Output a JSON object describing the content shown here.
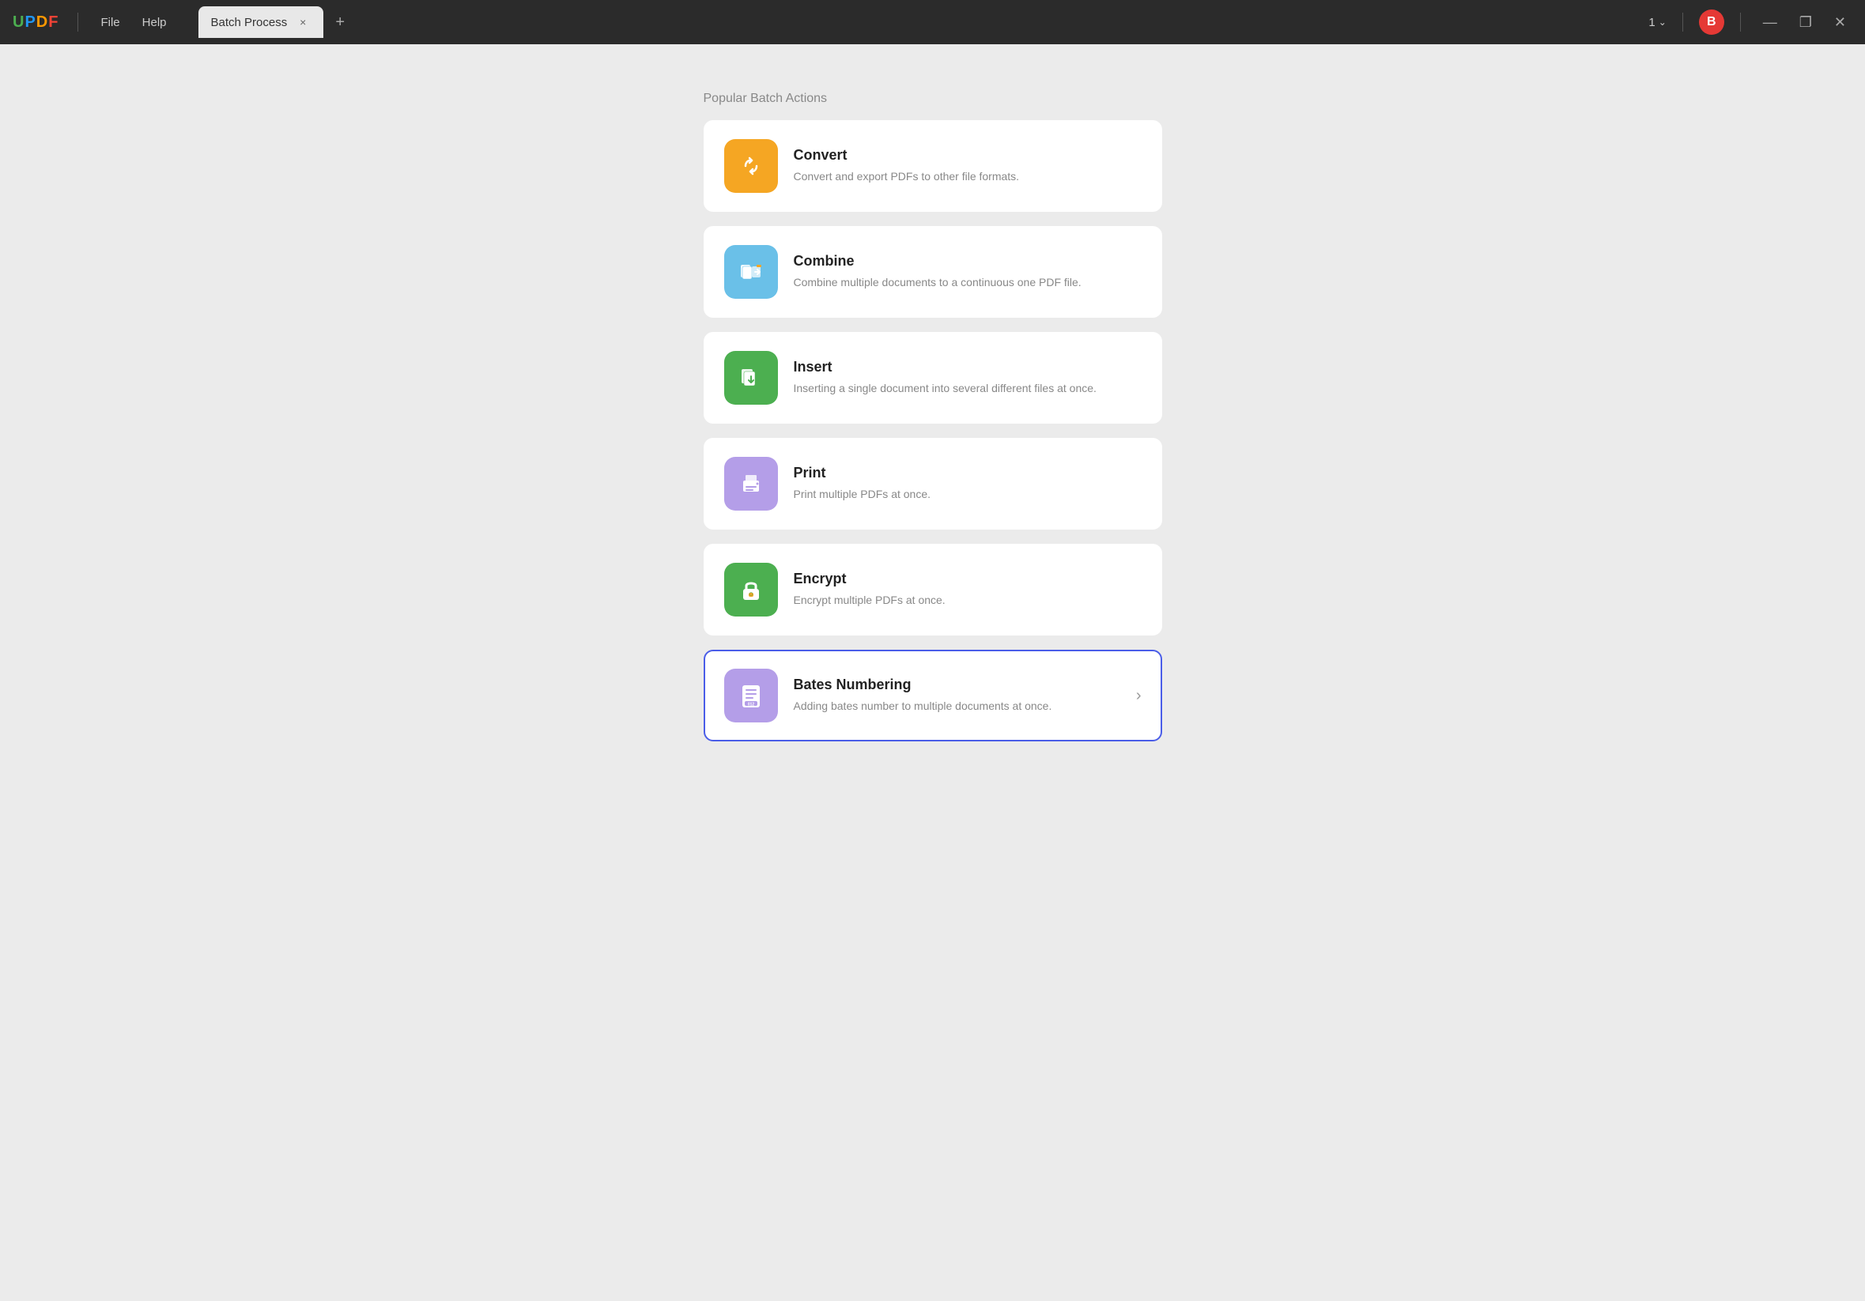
{
  "app": {
    "logo": "UPDF",
    "logo_letters": [
      "U",
      "P",
      "D",
      "F"
    ],
    "logo_colors": [
      "#4CAF50",
      "#2196F3",
      "#FF9800",
      "#F44336"
    ]
  },
  "titlebar": {
    "menu_items": [
      "File",
      "Help"
    ],
    "tab_label": "Batch Process",
    "tab_close_label": "×",
    "tab_add_label": "+",
    "window_count": "1",
    "user_initial": "B",
    "minimize_label": "—",
    "maximize_label": "❐",
    "close_label": "✕"
  },
  "main": {
    "section_title": "Popular Batch Actions",
    "actions": [
      {
        "id": "convert",
        "title": "Convert",
        "description": "Convert and export PDFs to other file formats.",
        "icon_type": "convert",
        "selected": false,
        "has_arrow": false
      },
      {
        "id": "combine",
        "title": "Combine",
        "description": "Combine multiple documents to a continuous one PDF file.",
        "icon_type": "combine",
        "selected": false,
        "has_arrow": false
      },
      {
        "id": "insert",
        "title": "Insert",
        "description": "Inserting a single document into several different files at once.",
        "icon_type": "insert",
        "selected": false,
        "has_arrow": false
      },
      {
        "id": "print",
        "title": "Print",
        "description": "Print multiple PDFs at once.",
        "icon_type": "print",
        "selected": false,
        "has_arrow": false
      },
      {
        "id": "encrypt",
        "title": "Encrypt",
        "description": "Encrypt multiple PDFs at once.",
        "icon_type": "encrypt",
        "selected": false,
        "has_arrow": false
      },
      {
        "id": "bates",
        "title": "Bates Numbering",
        "description": "Adding bates number to multiple documents at once.",
        "icon_type": "bates",
        "selected": true,
        "has_arrow": true
      }
    ]
  }
}
